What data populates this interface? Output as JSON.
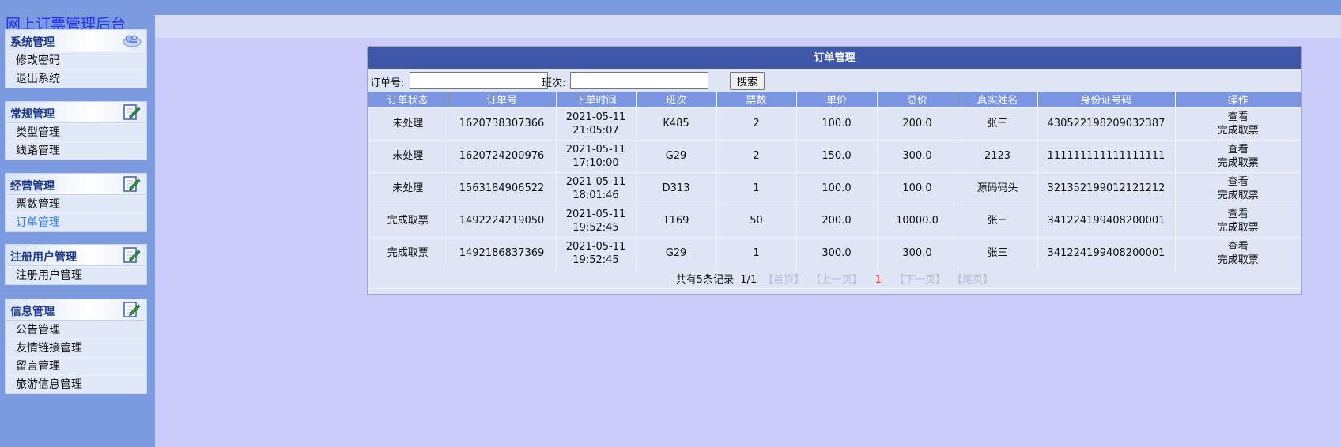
{
  "site_title": "网上订票管理后台",
  "sidebar": {
    "groups": [
      {
        "title": "系统管理",
        "icon": "tools-icon",
        "items": [
          "修改密码",
          "退出系统"
        ]
      },
      {
        "title": "常规管理",
        "icon": "edit-icon",
        "items": [
          "类型管理",
          "线路管理"
        ]
      },
      {
        "title": "经营管理",
        "icon": "edit-icon",
        "items": [
          "票数管理",
          "订单管理"
        ]
      },
      {
        "title": "注册用户管理",
        "icon": "edit-icon",
        "items": [
          "注册用户管理"
        ]
      },
      {
        "title": "信息管理",
        "icon": "edit-icon",
        "items": [
          "公告管理",
          "友情链接管理",
          "留言管理",
          "旅游信息管理"
        ]
      }
    ],
    "active_item": "订单管理"
  },
  "panel": {
    "title": "订单管理",
    "search": {
      "order_no_label": "订单号:",
      "order_no_value": "",
      "train_label": "班次:",
      "train_value": "",
      "button_label": "搜索"
    },
    "columns": [
      "订单状态",
      "订单号",
      "下单时间",
      "班次",
      "票数",
      "单价",
      "总价",
      "真实姓名",
      "身份证号码",
      "操作"
    ],
    "rows": [
      {
        "status": "未处理",
        "order_no": "1620738307366",
        "date": "2021-05-11",
        "time": "21:05:07",
        "train": "K485",
        "tickets": "2",
        "unit_price": "100.0",
        "total": "200.0",
        "name": "张三",
        "id_no": "430522198209032387"
      },
      {
        "status": "未处理",
        "order_no": "1620724200976",
        "date": "2021-05-11",
        "time": "17:10:00",
        "train": "G29",
        "tickets": "2",
        "unit_price": "150.0",
        "total": "300.0",
        "name": "2123",
        "id_no": "111111111111111111"
      },
      {
        "status": "未处理",
        "order_no": "1563184906522",
        "date": "2021-05-11",
        "time": "18:01:46",
        "train": "D313",
        "tickets": "1",
        "unit_price": "100.0",
        "total": "100.0",
        "name": "源码码头",
        "id_no": "321352199012121212"
      },
      {
        "status": "完成取票",
        "order_no": "1492224219050",
        "date": "2021-05-11",
        "time": "19:52:45",
        "train": "T169",
        "tickets": "50",
        "unit_price": "200.0",
        "total": "10000.0",
        "name": "张三",
        "id_no": "341224199408200001"
      },
      {
        "status": "完成取票",
        "order_no": "1492186837369",
        "date": "2021-05-11",
        "time": "19:52:45",
        "train": "G29",
        "tickets": "1",
        "unit_price": "300.0",
        "total": "300.0",
        "name": "张三",
        "id_no": "341224199408200001"
      }
    ],
    "actions": {
      "view": "查看",
      "complete": "完成取票"
    },
    "pager": {
      "total_text": "共有5条记录",
      "page_text": "1/1",
      "first": "【首页】",
      "prev": "【上一页】",
      "current": "1",
      "next": "【下一页】",
      "last": "【尾页】"
    }
  },
  "colors": {
    "sidebar_bg": "#7b9ae0",
    "main_bg": "#ccccfb",
    "panel_title_bg": "#3f57a8",
    "table_header_bg": "#7b95e0",
    "menu_title": "#1d3a8a",
    "site_title": "#2233ee"
  }
}
